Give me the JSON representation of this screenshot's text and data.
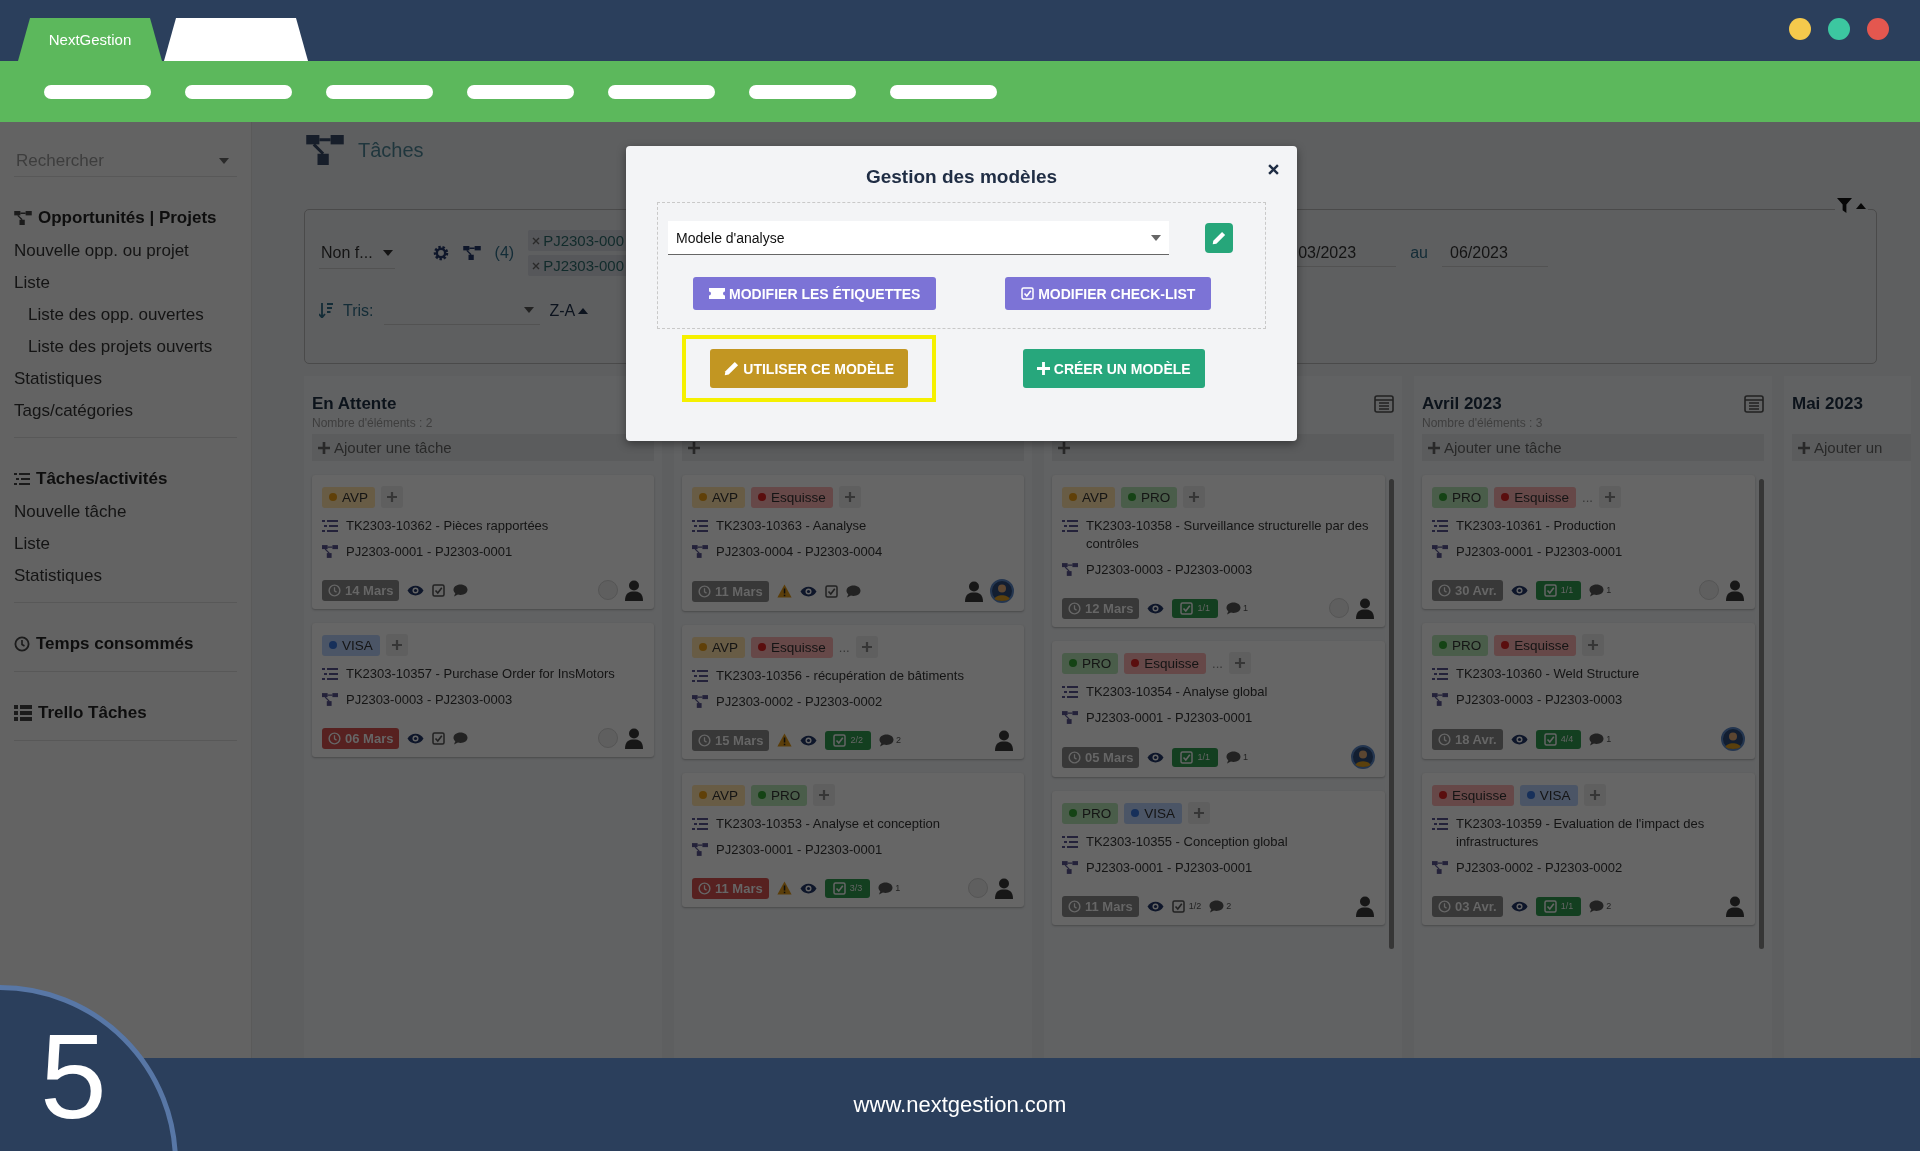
{
  "window": {
    "tabs": [
      {
        "label": "NextGestion",
        "selected": true
      },
      {
        "selected": false
      }
    ],
    "controls": [
      {
        "color": "#f5c94c"
      },
      {
        "color": "#3cc7a0"
      },
      {
        "color": "#e4574f"
      }
    ]
  },
  "sidebar": {
    "search": {
      "placeholder": "Rechercher"
    },
    "sections": [
      {
        "title": "Opportunités | Projets",
        "kind": "projects",
        "items": [
          {
            "label": "Nouvelle opp. ou projet"
          },
          {
            "label": "Liste",
            "children": [
              {
                "label": "Liste des opp. ouvertes"
              },
              {
                "label": "Liste des projets ouverts"
              }
            ]
          },
          {
            "label": "Statistiques"
          },
          {
            "label": "Tags/catégories"
          }
        ]
      },
      {
        "title": "Tâches/activités",
        "kind": "tasks",
        "items": [
          {
            "label": "Nouvelle tâche"
          },
          {
            "label": "Liste"
          },
          {
            "label": "Statistiques"
          }
        ]
      },
      {
        "title": "Temps consommés",
        "kind": "clock"
      },
      {
        "title": "Trello Tâches",
        "kind": "board"
      }
    ]
  },
  "page": {
    "title": "Tâches"
  },
  "filters": {
    "status": "Non f...",
    "project_count": "(4)",
    "project_chips": [
      "PJ2303-000",
      "PJ2303-000"
    ],
    "date_from": "03/2023",
    "date_separator": "au",
    "date_to": "06/2023",
    "sort_label": "Tris:",
    "sort_order": "Z-A"
  },
  "columns": [
    {
      "title": "En Attente",
      "count": "Nombre d'éléments : 2",
      "add_label": "Ajouter une tâche",
      "board_icon": false,
      "scrollbar": false,
      "cards": [
        {
          "tags": [
            {
              "label": "AVP",
              "color": "#604008"
            }
          ],
          "task": "TK2303-10362 - Pièces rapportées",
          "project": "PJ2303-0001 - PJ2303-0001",
          "due": {
            "label": "14 Mars",
            "overdue": false
          },
          "warning": false,
          "checklist": {
            "done": false
          },
          "avatars": [
            {
              "kind": "placeholder"
            },
            {
              "kind": "person"
            }
          ]
        },
        {
          "tags": [
            {
              "label": "VISA",
              "color": "#17305a"
            }
          ],
          "task": "TK2303-10357 - Purchase Order for InsMotors",
          "project": "PJ2303-0003 - PJ2303-0003",
          "due": {
            "label": "06 Mars",
            "overdue": true
          },
          "warning": false,
          "checklist": {
            "done": false
          },
          "avatars": [
            {
              "kind": "placeholder"
            },
            {
              "kind": "person"
            }
          ]
        }
      ]
    },
    {
      "board_icon": false,
      "scrollbar": false,
      "cards": [
        {
          "tags": [
            {
              "label": "AVP",
              "color": "#604008"
            },
            {
              "label": "Esquisse",
              "color": "#5a0e0e"
            }
          ],
          "task": "TK2303-10363 - Aanalyse",
          "project": "PJ2303-0004 - PJ2303-0004",
          "due": {
            "label": "11 Mars",
            "overdue": false
          },
          "warning": true,
          "checklist": {
            "done": false
          },
          "avatars": [
            {
              "kind": "person"
            },
            {
              "kind": "photo"
            }
          ]
        },
        {
          "tags": [
            {
              "label": "AVP",
              "color": "#604008"
            },
            {
              "label": "Esquisse",
              "color": "#5a0e0e"
            }
          ],
          "overflow": "...",
          "task": "TK2303-10356 - récupération de bâtiments",
          "project": "PJ2303-0002 - PJ2303-0002",
          "due": {
            "label": "15 Mars",
            "overdue": false
          },
          "warning": true,
          "checklist": {
            "done": true,
            "count": "2/2"
          },
          "comments": "2",
          "avatars": [
            {
              "kind": "person"
            }
          ]
        },
        {
          "tags": [
            {
              "label": "AVP",
              "color": "#604008"
            },
            {
              "label": "PRO",
              "color": "#154315"
            }
          ],
          "task": "TK2303-10353 - Analyse et conception",
          "project": "PJ2303-0001 - PJ2303-0001",
          "due": {
            "label": "11 Mars",
            "overdue": true
          },
          "warning": true,
          "checklist": {
            "done": true,
            "count": "3/3"
          },
          "comments": "1",
          "avatars": [
            {
              "kind": "placeholder"
            },
            {
              "kind": "person"
            }
          ]
        }
      ]
    },
    {
      "board_icon": true,
      "scrollbar": true,
      "cards": [
        {
          "tags": [
            {
              "label": "AVP",
              "color": "#604008"
            },
            {
              "label": "PRO",
              "color": "#154315"
            }
          ],
          "task": "TK2303-10358 - Surveillance structurelle par des contrôles",
          "project": "PJ2303-0003 - PJ2303-0003",
          "due": {
            "label": "12 Mars",
            "overdue": false
          },
          "warning": false,
          "checklist": {
            "done": true,
            "count": "1/1"
          },
          "comments": "1",
          "avatars": [
            {
              "kind": "placeholder"
            },
            {
              "kind": "person"
            }
          ]
        },
        {
          "tags": [
            {
              "label": "PRO",
              "color": "#154315"
            },
            {
              "label": "Esquisse",
              "color": "#5a0e0e"
            }
          ],
          "overflow": "...",
          "task": "TK2303-10354 - Analyse global",
          "project": "PJ2303-0001 - PJ2303-0001",
          "due": {
            "label": "05 Mars",
            "overdue": false
          },
          "warning": false,
          "checklist": {
            "done": true,
            "count": "1/1"
          },
          "comments": "1",
          "avatars": [
            {
              "kind": "photo"
            }
          ]
        },
        {
          "tags": [
            {
              "label": "PRO",
              "color": "#154315"
            },
            {
              "label": "VISA",
              "color": "#17305a"
            }
          ],
          "task": "TK2303-10355 - Conception global",
          "project": "PJ2303-0001 - PJ2303-0001",
          "due": {
            "label": "11 Mars",
            "overdue": false
          },
          "warning": false,
          "checklist": {
            "done": false,
            "count": "1/2"
          },
          "comments": "2",
          "avatars": [
            {
              "kind": "person"
            }
          ]
        }
      ]
    },
    {
      "title": "Avril 2023",
      "count": "Nombre d'éléments : 3",
      "add_label": "Ajouter une tâche",
      "board_icon": true,
      "scrollbar": true,
      "cards": [
        {
          "tags": [
            {
              "label": "PRO",
              "color": "#154315"
            },
            {
              "label": "Esquisse",
              "color": "#5a0e0e"
            }
          ],
          "overflow": "...",
          "task": "TK2303-10361 - Production",
          "project": "PJ2303-0001 - PJ2303-0001",
          "due": {
            "label": "30 Avr.",
            "overdue": false
          },
          "warning": false,
          "checklist": {
            "done": true,
            "count": "1/1"
          },
          "comments": "1",
          "avatars": [
            {
              "kind": "placeholder"
            },
            {
              "kind": "person"
            }
          ]
        },
        {
          "tags": [
            {
              "label": "PRO",
              "color": "#154315"
            },
            {
              "label": "Esquisse",
              "color": "#5a0e0e"
            }
          ],
          "task": "TK2303-10360 - Weld Structure",
          "project": "PJ2303-0003 - PJ2303-0003",
          "due": {
            "label": "18 Avr.",
            "overdue": false
          },
          "warning": false,
          "checklist": {
            "done": true,
            "count": "4/4"
          },
          "comments": "1",
          "avatars": [
            {
              "kind": "photo"
            }
          ]
        },
        {
          "tags": [
            {
              "label": "Esquisse",
              "color": "#5a0e0e"
            },
            {
              "label": "VISA",
              "color": "#17305a"
            }
          ],
          "task": "TK2303-10359 - Evaluation de l'impact des infrastructures",
          "project": "PJ2303-0002 - PJ2303-0002",
          "due": {
            "label": "03 Avr.",
            "overdue": false
          },
          "warning": false,
          "checklist": {
            "done": true,
            "count": "1/1"
          },
          "comments": "2",
          "avatars": [
            {
              "kind": "person"
            }
          ]
        }
      ]
    },
    {
      "title": "Mai 2023",
      "add_label": "Ajouter un",
      "board_icon": false,
      "scrollbar": false
    }
  ],
  "modal": {
    "title": "Gestion des modèles",
    "template": "Modele d'analyse",
    "buttons": [
      {
        "label": "MODIFIER LES ÉTIQUETTES",
        "kind": "labels"
      },
      {
        "label": "MODIFIER CHECK-LIST",
        "kind": "checklist"
      }
    ],
    "actions": [
      {
        "label": "UTILISER CE MODÈLE",
        "kind": "use",
        "highlighted": true
      },
      {
        "label": "CRÉER UN MODÈLE",
        "kind": "create",
        "highlighted": false
      }
    ]
  },
  "footer": {
    "url": "www.nextgestion.com",
    "step": "5"
  }
}
